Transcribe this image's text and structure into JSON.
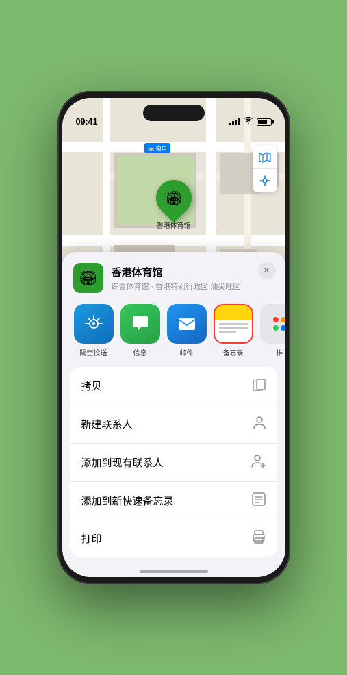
{
  "phone": {
    "time": "09:41",
    "location_arrow": "▶"
  },
  "map": {
    "road_label": "南口",
    "pin_label": "香港体育馆",
    "map_btn_1": "🗺",
    "map_btn_2": "➤"
  },
  "sheet": {
    "venue_name": "香港体育馆",
    "venue_subtitle": "综合体育馆 · 香港特别行政区 油尖旺区",
    "close": "✕"
  },
  "share_apps": [
    {
      "label": "隔空投送",
      "type": "airdrop"
    },
    {
      "label": "信息",
      "type": "message"
    },
    {
      "label": "邮件",
      "type": "mail"
    },
    {
      "label": "备忘录",
      "type": "notes",
      "selected": true
    }
  ],
  "actions": [
    {
      "label": "拷贝",
      "icon": "copy"
    },
    {
      "label": "新建联系人",
      "icon": "person"
    },
    {
      "label": "添加到现有联系人",
      "icon": "person-add"
    },
    {
      "label": "添加到新快速备忘录",
      "icon": "note"
    },
    {
      "label": "打印",
      "icon": "printer"
    }
  ],
  "colors": {
    "green": "#2d9e2d",
    "blue": "#007aff",
    "red": "#ff3b30"
  }
}
